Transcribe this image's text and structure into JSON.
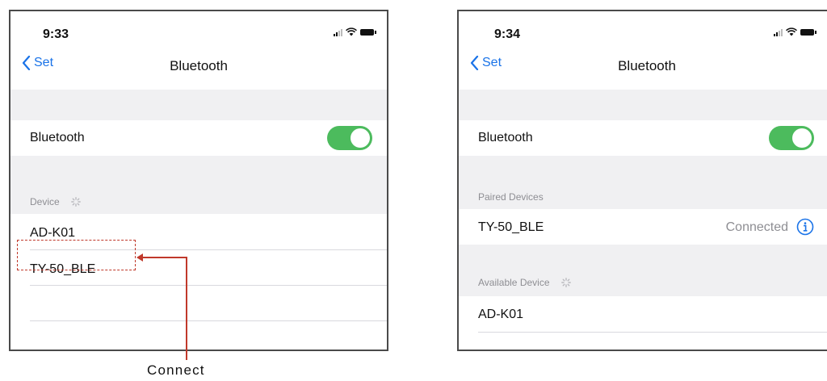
{
  "left": {
    "time": "9:33",
    "back_label": "Set",
    "title": "Bluetooth",
    "bluetooth_label": "Bluetooth",
    "bluetooth_on": true,
    "device_header": "Device",
    "devices": [
      "AD-K01",
      "TY-50_BLE"
    ]
  },
  "right": {
    "time": "9:34",
    "back_label": "Set",
    "title": "Bluetooth",
    "bluetooth_label": "Bluetooth",
    "bluetooth_on": true,
    "paired_header": "Paired Devices",
    "paired_devices": [
      {
        "name": "TY-50_BLE",
        "status": "Connected"
      }
    ],
    "available_header": "Available Device",
    "available_devices": [
      "AD-K01"
    ]
  },
  "annotation": {
    "label": "Connect",
    "color": "#c0392b"
  },
  "colors": {
    "accent": "#1a73e8",
    "toggle_on": "#4cbb5d",
    "section_bg": "#f0f0f2"
  },
  "icons": [
    "signal-icon",
    "wifi-icon",
    "battery-icon",
    "chevron-left-icon",
    "spinner-icon",
    "info-icon"
  ]
}
